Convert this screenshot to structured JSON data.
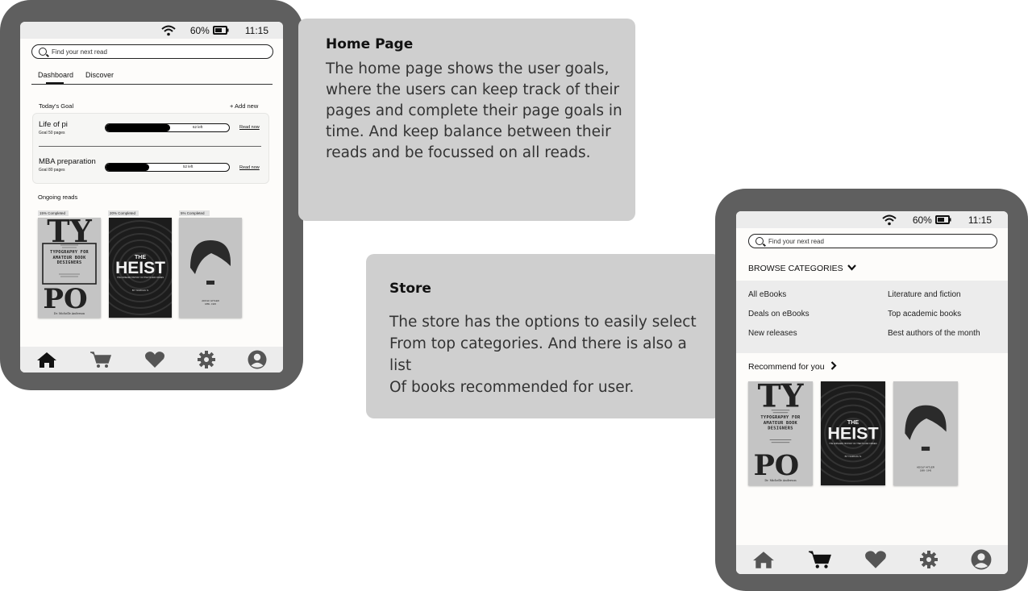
{
  "home_card": {
    "title": "Home Page",
    "body": "The home page shows the user goals,\nwhere the users can keep track of their\npages and complete their page goals in\ntime. And keep balance between their\nreads and be focussed on all reads."
  },
  "store_card": {
    "title": "Store",
    "body": "The store has the options to easily select\nFrom top categories. And there is also a list\nOf books recommended for user."
  },
  "status": {
    "battery": "60%",
    "time": "11:15"
  },
  "home": {
    "search_placeholder": "Find your next read",
    "tabs": [
      "Dashboard",
      "Discover"
    ],
    "goal_header": "Today's Goal",
    "add_new": "+ Add new",
    "goals": [
      {
        "name": "Life of pi",
        "sub": "Goal   50 pages",
        "left": "62 left",
        "progress": 0.52,
        "action": "Read now"
      },
      {
        "name": "MBA preparation",
        "sub": "Goal   80 pages",
        "left": "52 left",
        "progress": 0.35,
        "action": "Read now"
      }
    ],
    "ongoing_header": "Ongoing reads",
    "ongoing": [
      {
        "badge": "15%  Completed",
        "book": "typo"
      },
      {
        "badge": "20%  Completed",
        "book": "heist"
      },
      {
        "badge": "5% Completed",
        "book": "portrait"
      }
    ]
  },
  "store": {
    "search_placeholder": "Find your next read",
    "browse_label": "BROWSE CATEGORIES",
    "categories_left": [
      "All eBooks",
      "Deals on eBooks",
      "New releases"
    ],
    "categories_right": [
      "Literature and fiction",
      "Top academic books",
      "Best authors of the month"
    ],
    "recommend_label": "Recommend for you"
  },
  "books": {
    "typo": {
      "big_top": "TY",
      "big_bottom": "PO",
      "title": "TYPOGRAPHY FOR AMATEUR BOOK DESIGNERS",
      "author": "Dr. Michelle Anderson"
    },
    "heist": {
      "the": "THE",
      "title": "HEIST",
      "subtitle": "THE UNHEARD HISTORY OF THEFTS AND CRIMES",
      "author": "BY NARCAU S"
    },
    "portrait": {
      "caption": "ADOLF HITLER",
      "dates": "1889 - 1945"
    }
  },
  "nav": [
    "home-icon",
    "cart-icon",
    "heart-icon",
    "gear-icon",
    "user-icon"
  ],
  "colors": {
    "frame": "#5f5f5f",
    "card": "#cfcfcf",
    "screen": "#fdfcfa",
    "bar": "#ececec",
    "active_nav": "#111111",
    "inactive_nav": "#555555"
  }
}
